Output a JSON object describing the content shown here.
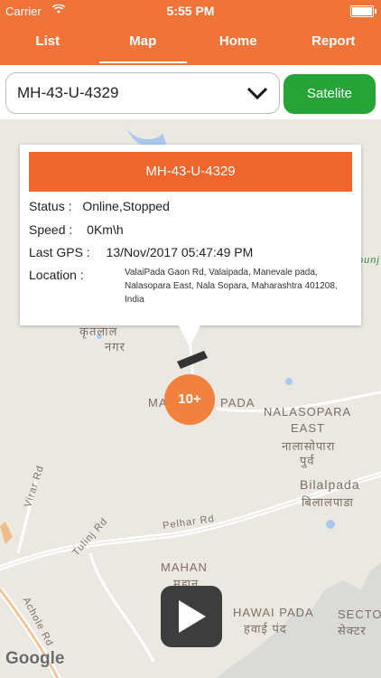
{
  "status_bar": {
    "carrier": "Carrier",
    "time": "5:55 PM"
  },
  "tabs": [
    {
      "label": "List",
      "active": false
    },
    {
      "label": "Map",
      "active": true
    },
    {
      "label": "Home",
      "active": false
    },
    {
      "label": "Report",
      "active": false
    }
  ],
  "vehicle_select": {
    "value": "MH-43-U-4329"
  },
  "satellite_button": "Satelite",
  "popup": {
    "title": "MH-43-U-4329",
    "status_label": "Status :",
    "status_value": "Online,Stopped",
    "speed_label": "Speed :",
    "speed_value": "0Km\\h",
    "gps_label": "Last GPS :",
    "gps_value": "13/Nov/2017 05:47:49 PM",
    "location_label": "Location :",
    "location_value": "ValaiPada Gaon Rd, Valaipada, Manevale pada, Nalasopara East, Nala Sopara, Maharashtra 401208, India"
  },
  "map": {
    "labels": {
      "marathi_nagar": "नगर",
      "marathi_partial": "कृतलाल",
      "manevale_pada": "MA",
      "pada": "PADA",
      "nalasopara_east_1": "NALASOPARA",
      "nalasopara_east_2": "EAST",
      "nalasopara_marathi_1": "नालासोपारा",
      "nalasopara_marathi_2": "पुर्व",
      "bilalpada": "Bilalpada",
      "bilalpada_marathi": "बिलालपाडा",
      "pelhar_rd": "Pelhar Rd",
      "tulinj_rd": "Tulinj Rd",
      "virar_rd": "Virar Rd",
      "mahan": "MAHAN",
      "mahan_marathi": "महान",
      "hawai_pada": "HAWAI PADA",
      "hawai_pada_marathi": "हवाई पंद",
      "sector": "SECTO",
      "sector_marathi": "सेक्टर",
      "acholo_rd": "Achole Rd",
      "ounj": "ounj"
    },
    "cluster_count": "10+",
    "attribution": "Google"
  },
  "colors": {
    "accent": "#f0743a",
    "popup_header": "#f0652c",
    "satellite": "#27a437",
    "cluster": "#f0813f"
  }
}
